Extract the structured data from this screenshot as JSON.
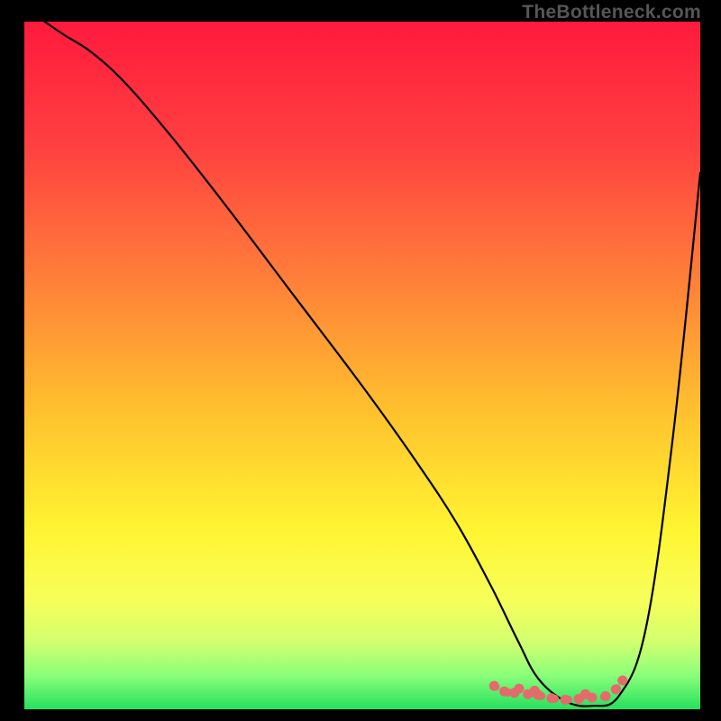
{
  "watermark": "TheBottleneck.com",
  "chart_data": {
    "type": "line",
    "title": "",
    "xlabel": "",
    "ylabel": "",
    "xlim": [
      0,
      100
    ],
    "ylim": [
      0,
      100
    ],
    "grid": false,
    "legend": false,
    "gradient_stops": [
      {
        "offset": 0,
        "color": "#ff1a3d"
      },
      {
        "offset": 18,
        "color": "#ff4040"
      },
      {
        "offset": 36,
        "color": "#ff7a3a"
      },
      {
        "offset": 56,
        "color": "#ffbf2e"
      },
      {
        "offset": 74,
        "color": "#fff531"
      },
      {
        "offset": 84,
        "color": "#f7ff5a"
      },
      {
        "offset": 90,
        "color": "#d4ff6e"
      },
      {
        "offset": 95,
        "color": "#8cff7a"
      },
      {
        "offset": 100,
        "color": "#25e05e"
      }
    ],
    "series": [
      {
        "name": "bottleneck-curve",
        "color": "#000000",
        "x": [
          3,
          6,
          10,
          15,
          22,
          30,
          40,
          50,
          58,
          64,
          69,
          73,
          76,
          80,
          84,
          88,
          92,
          96,
          100
        ],
        "y": [
          100,
          98,
          95.5,
          91,
          83,
          73,
          60,
          47,
          36,
          27,
          18,
          10,
          4.5,
          1.2,
          0.5,
          2,
          12,
          40,
          78
        ]
      },
      {
        "name": "highlight-segment",
        "color": "#e36b6b",
        "x": [
          69.5,
          71,
          72.5,
          73.2,
          74.5,
          75.5,
          76,
          78,
          80,
          82,
          83,
          84,
          86,
          87.5,
          88.5
        ],
        "y": [
          3.4,
          2.6,
          2.4,
          3.0,
          2.2,
          2.7,
          2.1,
          1.6,
          1.4,
          1.5,
          2.2,
          1.7,
          1.9,
          2.9,
          4.2
        ]
      }
    ],
    "annotations": []
  }
}
